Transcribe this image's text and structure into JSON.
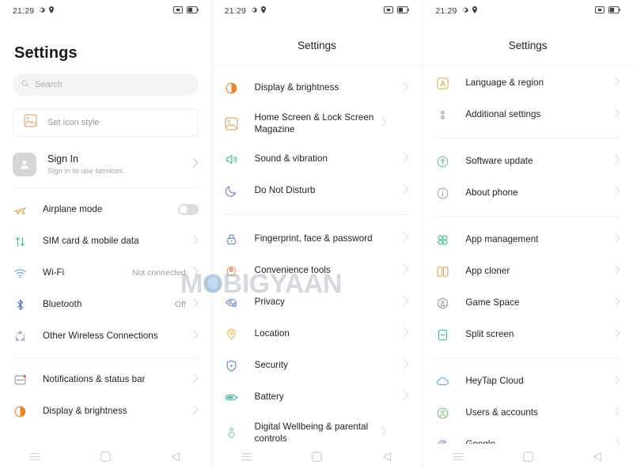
{
  "statusbar": {
    "time": "21:29",
    "icons_left": [
      "gear-icon",
      "location-icon"
    ],
    "icons_right": [
      "cast-icon",
      "battery-icon"
    ]
  },
  "navbar": {
    "menu": "menu-icon",
    "home": "home-icon",
    "back": "back-icon"
  },
  "watermark": {
    "text": "MOBIGYAAN"
  },
  "colors": {
    "orange": "#e8862e",
    "tan": "#d9a06a",
    "green": "#3fba8c",
    "purple": "#7a74c4",
    "blue": "#5b7fc7",
    "yellow": "#e0b64a",
    "teal": "#36b89a",
    "gray": "#8c8c8c",
    "divider": "#eeeeee",
    "label": "#222222",
    "value": "#9b9b9b"
  },
  "screen1": {
    "title": "Settings",
    "search": {
      "placeholder": "Search",
      "icon": "search-icon"
    },
    "icon_style": {
      "label": "Set icon style",
      "icon": "picture-icon"
    },
    "account": {
      "title": "Sign In",
      "subtitle": "Sign in to use services.",
      "avatar": "person-avatar"
    },
    "items": [
      {
        "label": "Airplane mode",
        "icon": "airplane-icon",
        "color": "#e0a45c",
        "control": "toggle",
        "toggle_on": false,
        "value": ""
      },
      {
        "label": "SIM card & mobile data",
        "icon": "sim-arrows-icon",
        "color": "#3fba8c",
        "control": "chevron",
        "value": ""
      },
      {
        "label": "Wi-Fi",
        "icon": "wifi-icon",
        "color": "#4f9fd8",
        "control": "chevron",
        "value": "Not connected"
      },
      {
        "label": "Bluetooth",
        "icon": "bluetooth-icon",
        "color": "#3f63c8",
        "control": "chevron",
        "value": "Off"
      },
      {
        "label": "Other Wireless Connections",
        "icon": "wireless-icon",
        "color": "#9aa3ae",
        "control": "chevron",
        "value": ""
      },
      {
        "divider": true
      },
      {
        "label": "Notifications & status bar",
        "icon": "notification-icon",
        "color": "#8b8fa0",
        "control": "chevron",
        "value": ""
      },
      {
        "label": "Display & brightness",
        "icon": "brightness-icon",
        "color": "#e8862e",
        "control": "chevron",
        "value": ""
      }
    ]
  },
  "screen2": {
    "title": "Settings",
    "items": [
      {
        "label": "Display & brightness",
        "icon": "brightness-icon",
        "color": "#e8862e",
        "control": "chevron",
        "value": ""
      },
      {
        "label": "Home Screen & Lock Screen Magazine",
        "icon": "picture-icon",
        "color": "#d9a06a",
        "control": "chevron",
        "value": ""
      },
      {
        "label": "Sound & vibration",
        "icon": "speaker-icon",
        "color": "#3fba8c",
        "control": "chevron",
        "value": ""
      },
      {
        "label": "Do Not Disturb",
        "icon": "moon-icon",
        "color": "#7a74c4",
        "control": "chevron",
        "value": ""
      },
      {
        "divider": true
      },
      {
        "label": "Fingerprint, face & password",
        "icon": "lock-icon",
        "color": "#5b7fc7",
        "control": "chevron",
        "value": ""
      },
      {
        "label": "Convenience tools",
        "icon": "head-icon",
        "color": "#e09a50",
        "control": "chevron",
        "value": ""
      },
      {
        "label": "Privacy",
        "icon": "privacy-eye-icon",
        "color": "#5b7fc7",
        "control": "chevron",
        "value": ""
      },
      {
        "label": "Location",
        "icon": "location-pin-icon",
        "color": "#e0b64a",
        "control": "chevron",
        "value": ""
      },
      {
        "label": "Security",
        "icon": "shield-icon",
        "color": "#5b7fc7",
        "control": "chevron",
        "value": ""
      },
      {
        "label": "Battery",
        "icon": "battery-icon",
        "color": "#36b89a",
        "control": "chevron",
        "value": ""
      },
      {
        "label": "Digital Wellbeing & parental controls",
        "icon": "heart-person-icon",
        "color": "#7dc7a8",
        "control": "chevron",
        "value": ""
      }
    ]
  },
  "screen3": {
    "title": "Settings",
    "items": [
      {
        "label": "Language & region",
        "icon": "letter-a-icon",
        "color": "#d9a84a",
        "control": "chevron",
        "value": ""
      },
      {
        "label": "Additional settings",
        "icon": "dots-icon",
        "color": "#8c8c8c",
        "control": "chevron",
        "value": ""
      },
      {
        "divider": true
      },
      {
        "label": "Software update",
        "icon": "update-arrow-icon",
        "color": "#7dbd9a",
        "control": "chevron",
        "value": ""
      },
      {
        "label": "About phone",
        "icon": "info-icon",
        "color": "#9aa3ae",
        "control": "chevron",
        "value": ""
      },
      {
        "divider": true
      },
      {
        "label": "App management",
        "icon": "apps-grid-icon",
        "color": "#36b89a",
        "control": "chevron",
        "value": ""
      },
      {
        "label": "App cloner",
        "icon": "clone-icon",
        "color": "#e0a45c",
        "control": "chevron",
        "value": ""
      },
      {
        "label": "Game Space",
        "icon": "game-icon",
        "color": "#8c8c8c",
        "control": "chevron",
        "value": ""
      },
      {
        "label": "Split screen",
        "icon": "split-screen-icon",
        "color": "#36b89a",
        "control": "chevron",
        "value": ""
      },
      {
        "divider": true
      },
      {
        "label": "HeyTap Cloud",
        "icon": "cloud-icon",
        "color": "#5b9fd8",
        "control": "chevron",
        "value": ""
      },
      {
        "label": "Users & accounts",
        "icon": "user-circle-icon",
        "color": "#7dbd8a",
        "control": "chevron",
        "value": ""
      },
      {
        "label": "Google",
        "icon": "google-icon",
        "color": "#7a8fd8",
        "control": "chevron",
        "value": ""
      }
    ]
  }
}
